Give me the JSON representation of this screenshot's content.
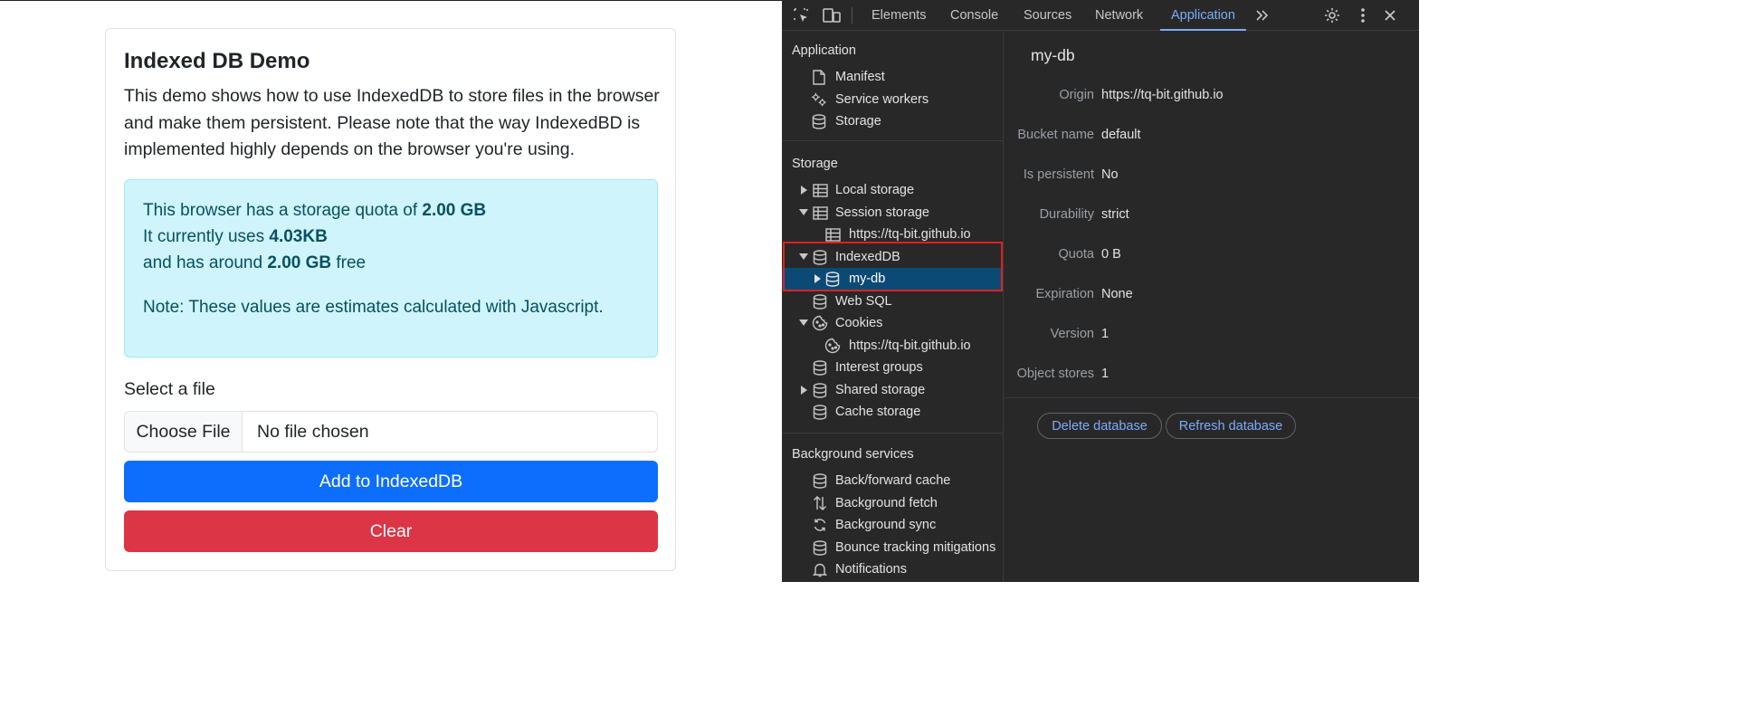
{
  "page": {
    "title": "Indexed DB Demo",
    "description": "This demo shows how to use IndexedDB to store files in the browser and make them persistent. Please note that the way IndexedBD is implemented highly depends on the browser you're using.",
    "info": {
      "quota_prefix": "This browser has a storage quota of ",
      "quota_value": "2.00 GB",
      "uses_prefix": "It currently uses ",
      "uses_value": "4.03KB",
      "free_prefix": "and has around ",
      "free_value": "2.00 GB",
      "free_suffix": " free",
      "note": "Note: These values are estimates calculated with Javascript."
    },
    "select_label": "Select a file",
    "choose_file_label": "Choose File",
    "no_file_text": "No file chosen",
    "add_button": "Add to IndexedDB",
    "clear_button": "Clear"
  },
  "devtools": {
    "tabs": [
      "Elements",
      "Console",
      "Sources",
      "Network",
      "Application"
    ],
    "active_tab": "Application",
    "sidebar": {
      "application_title": "Application",
      "application_items": [
        "Manifest",
        "Service workers",
        "Storage"
      ],
      "storage_title": "Storage",
      "storage_items": {
        "local_storage": "Local storage",
        "session_storage": "Session storage",
        "session_origin": "https://tq-bit.github.io",
        "indexeddb": "IndexedDB",
        "my_db": "my-db",
        "web_sql": "Web SQL",
        "cookies": "Cookies",
        "cookies_origin": "https://tq-bit.github.io",
        "interest_groups": "Interest groups",
        "shared_storage": "Shared storage",
        "cache_storage": "Cache storage"
      },
      "background_title": "Background services",
      "background_items": [
        "Back/forward cache",
        "Background fetch",
        "Background sync",
        "Bounce tracking mitigations",
        "Notifications"
      ]
    },
    "detail": {
      "title": "my-db",
      "rows": [
        {
          "key": "Origin",
          "value": "https://tq-bit.github.io"
        },
        {
          "key": "Bucket name",
          "value": "default"
        },
        {
          "key": "Is persistent",
          "value": "No"
        },
        {
          "key": "Durability",
          "value": "strict"
        },
        {
          "key": "Quota",
          "value": "0 B"
        },
        {
          "key": "Expiration",
          "value": "None"
        },
        {
          "key": "Version",
          "value": "1"
        },
        {
          "key": "Object stores",
          "value": "1"
        }
      ],
      "delete_button": "Delete database",
      "refresh_button": "Refresh database"
    },
    "colors": {
      "accent": "#7cacf8",
      "selected_row": "#0b4a75",
      "highlight": "#e02020"
    }
  }
}
